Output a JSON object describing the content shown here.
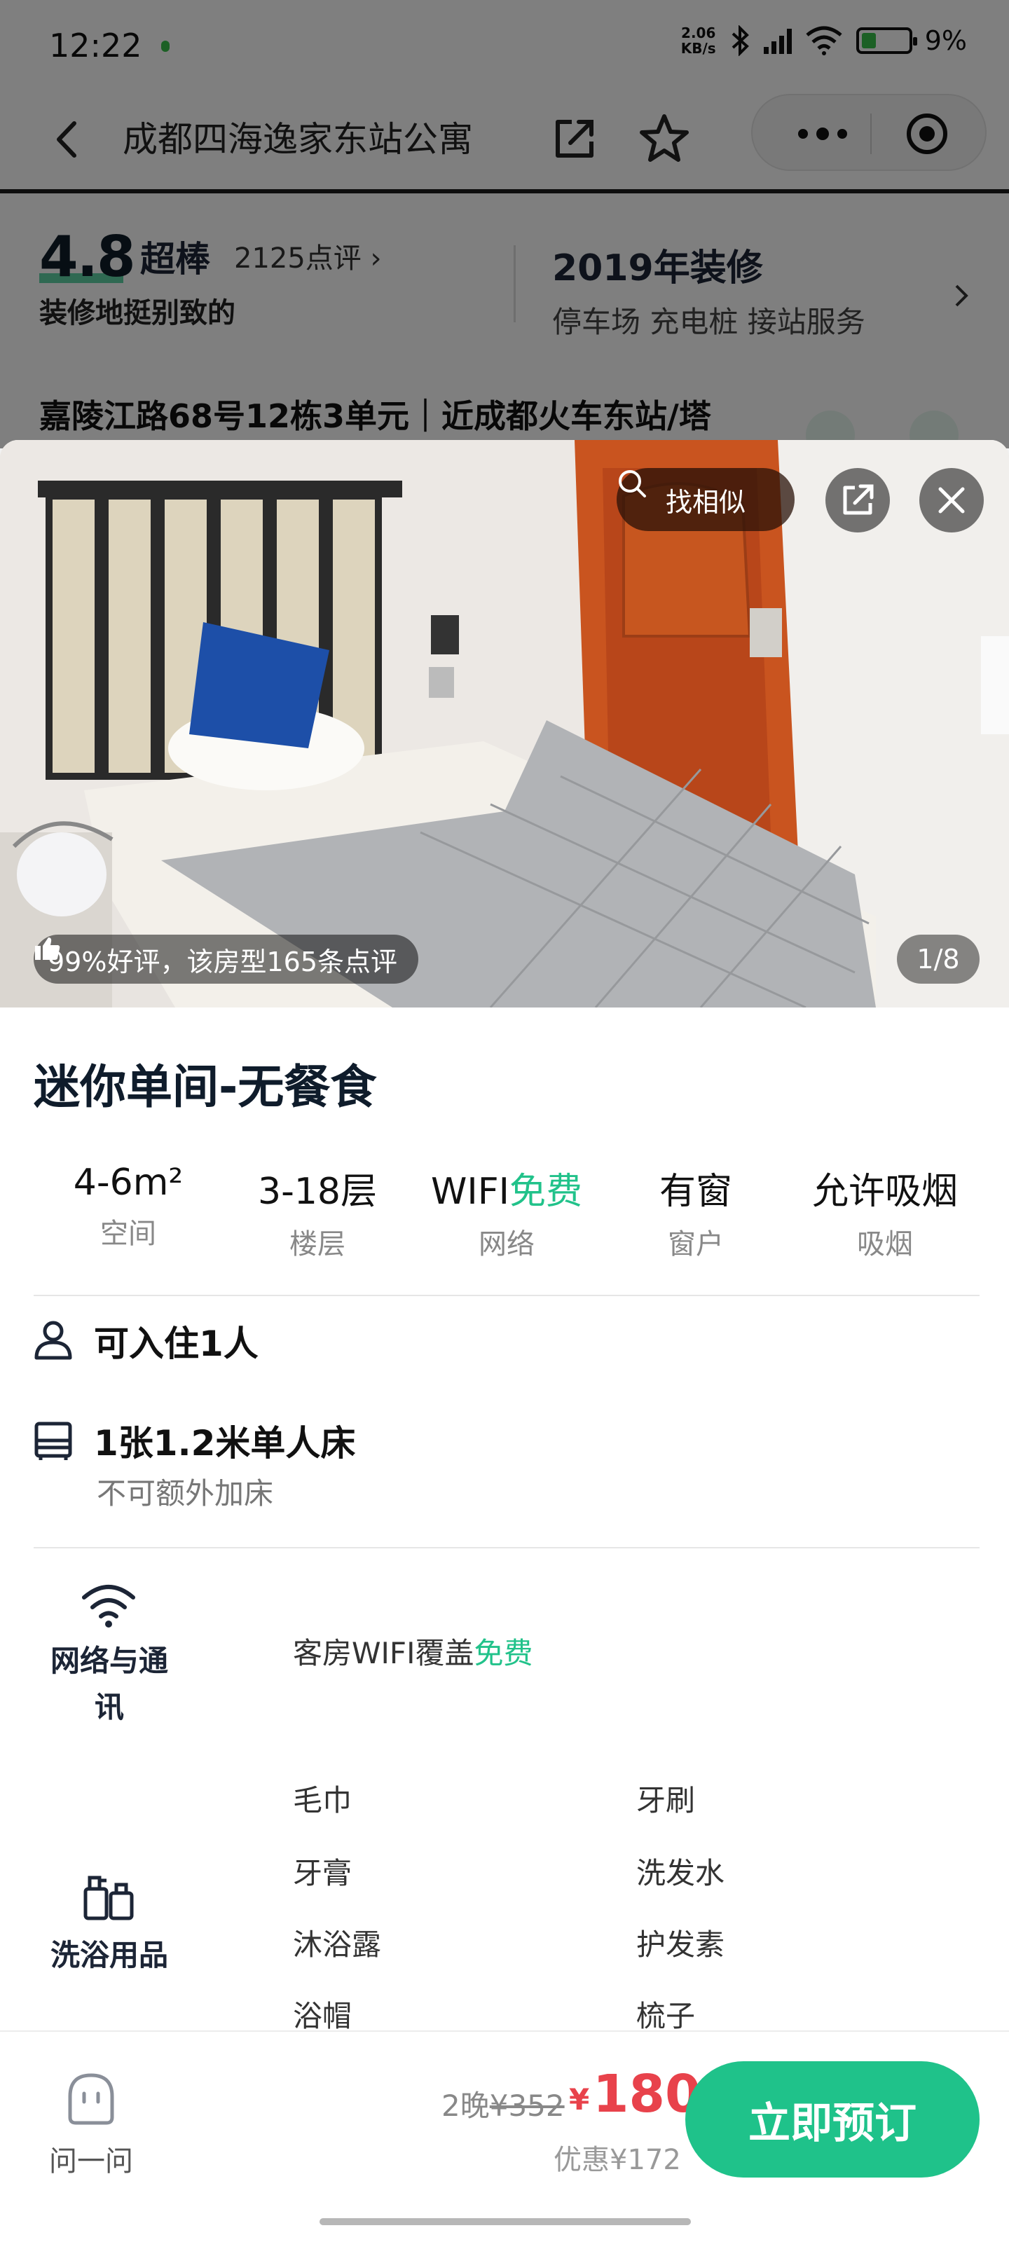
{
  "status_bar": {
    "time": "12:22",
    "net_speed_top": "2.06",
    "net_speed_bottom": "KB/s",
    "battery": "9%"
  },
  "nav": {
    "title": "成都四海逸家东站公寓"
  },
  "rating": {
    "score": "4.8",
    "word": "超棒",
    "review_count": "2125点评",
    "summary": "装修地挺别致的",
    "renovation": "2019年装修",
    "facilities": "停车场 充电桩 接站服务"
  },
  "address": "嘉陵江路68号12栋3单元｜近成都火车东站/塔",
  "photo": {
    "find_similar": "找相似",
    "good_rating": "99%好评，该房型165条点评",
    "pager": "1/8"
  },
  "room": {
    "title": "迷你单间-无餐食",
    "specs": [
      {
        "value": "4-6m²",
        "label": "空间"
      },
      {
        "value": "3-18层",
        "label": "楼层"
      },
      {
        "value": "WIFI",
        "value_free": "免费",
        "label": "网络"
      },
      {
        "value": "有窗",
        "label": "窗户"
      },
      {
        "value": "允许吸烟",
        "label": "吸烟"
      }
    ],
    "occupancy": "可入住1人",
    "bed": "1张1.2米单人床",
    "bed_note": "不可额外加床"
  },
  "amenities": {
    "network": {
      "label_line1": "网络与通",
      "label_line2": "讯",
      "text": "客房WIFI覆盖",
      "text_free": "免费"
    },
    "bath": {
      "label": "洗浴用品",
      "items": [
        "毛巾",
        "牙刷",
        "牙膏",
        "洗发水",
        "沐浴露",
        "护发素",
        "浴帽",
        "梳子"
      ]
    }
  },
  "bottom": {
    "ask": "问一问",
    "nights": "2晚",
    "old_price": "¥352",
    "currency": "¥",
    "price": "180",
    "discount": "优惠¥172",
    "book": "立即预订"
  },
  "colors": {
    "accent": "#1fc28a",
    "price": "#e8424b"
  }
}
